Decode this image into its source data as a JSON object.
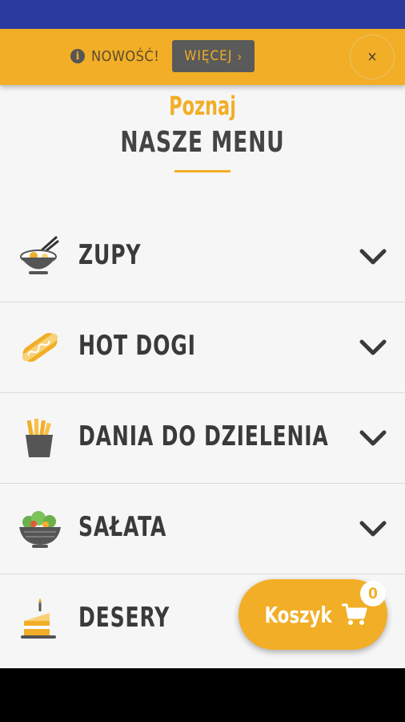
{
  "notice": {
    "info_icon": "info-circle-icon",
    "text": "NOWOŚĆ!",
    "more_label": "WIĘCEJ",
    "close_label": "×"
  },
  "hero": {
    "subtitle": "Poznaj",
    "title": "NASZE MENU"
  },
  "menu": {
    "items": [
      {
        "label": "ZUPY",
        "icon": "soup-bowl-icon"
      },
      {
        "label": "HOT DOGI",
        "icon": "hot-dog-icon"
      },
      {
        "label": "DANIA DO DZIELENIA",
        "icon": "fries-icon"
      },
      {
        "label": "SAŁATA",
        "icon": "salad-bowl-icon"
      },
      {
        "label": "DESERY",
        "icon": "cake-slice-icon"
      }
    ]
  },
  "cart": {
    "label": "Koszyk",
    "count": "0"
  },
  "colors": {
    "accent": "#f2ae26",
    "status_bar": "#2b3a9e",
    "text_dark": "#3a3a3a",
    "background": "#f6f6f6"
  }
}
